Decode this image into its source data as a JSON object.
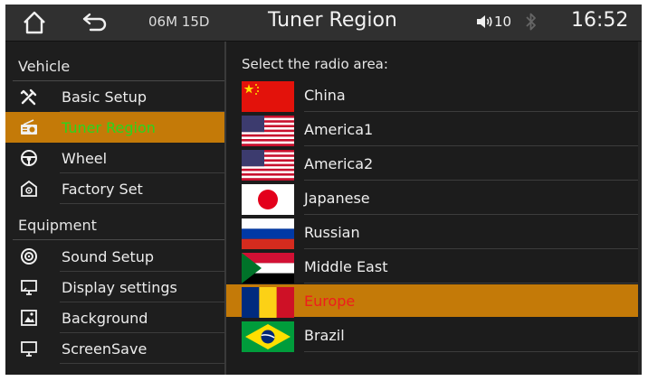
{
  "topbar": {
    "status": "06M 15D",
    "title": "Tuner Region",
    "volume": "10",
    "time": "16:52"
  },
  "sidebar": {
    "sections": [
      {
        "label": "Vehicle"
      },
      {
        "label": "Equipment"
      }
    ],
    "items": [
      {
        "label": "Basic Setup",
        "icon": "tools-icon"
      },
      {
        "label": "Tuner Region",
        "icon": "radio-icon",
        "active": true
      },
      {
        "label": "Wheel",
        "icon": "steering-wheel-icon"
      },
      {
        "label": "Factory Set",
        "icon": "factory-icon"
      },
      {
        "label": "Sound Setup",
        "icon": "speaker-icon"
      },
      {
        "label": "Display settings",
        "icon": "display-icon"
      },
      {
        "label": "Background",
        "icon": "background-icon"
      },
      {
        "label": "ScreenSave",
        "icon": "monitor-icon"
      }
    ]
  },
  "main": {
    "prompt": "Select the radio area:",
    "regions": [
      {
        "label": "China",
        "flag": "china-flag-icon"
      },
      {
        "label": "America1",
        "flag": "usa-flag-icon"
      },
      {
        "label": "America2",
        "flag": "usa-flag-icon"
      },
      {
        "label": "Japanese",
        "flag": "japan-flag-icon"
      },
      {
        "label": "Russian",
        "flag": "russia-flag-icon"
      },
      {
        "label": "Middle East",
        "flag": "middle-east-flag-icon"
      },
      {
        "label": "Europe",
        "flag": "europe-flag-icon",
        "selected": true
      },
      {
        "label": "Brazil",
        "flag": "brazil-flag-icon"
      }
    ]
  },
  "colors": {
    "highlight": "#c47a08",
    "active_sidebar_text": "#2ad61e",
    "selected_region_text": "#ee1d1d",
    "background": "#1c1c1c"
  }
}
